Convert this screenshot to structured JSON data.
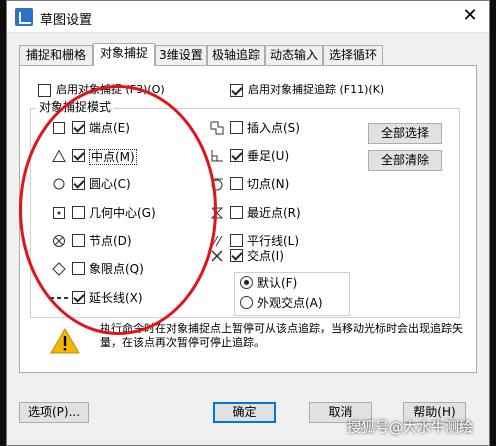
{
  "window": {
    "title": "草图设置",
    "close_symbol": "✕"
  },
  "tabs": [
    {
      "label": "捕捉和栅格"
    },
    {
      "label": "对象捕捉",
      "active": true
    },
    {
      "label": "3维设置"
    },
    {
      "label": "极轴追踪"
    },
    {
      "label": "动态输入"
    },
    {
      "label": "选择循环"
    }
  ],
  "top_checks": {
    "snap_on": {
      "label": "启用对象捕捉 (F3)(O)",
      "checked": false
    },
    "tracking_on": {
      "label": "启用对象捕捉追踪 (F11)(K)",
      "checked": true
    }
  },
  "group_title": "对象捕捉模式",
  "snap_left": [
    {
      "label": "端点(E)",
      "checked": true,
      "icon": "endpoint-square"
    },
    {
      "label": "中点(M)",
      "checked": true,
      "icon": "midpoint-triangle"
    },
    {
      "label": "圆心(C)",
      "checked": true,
      "icon": "center-circle"
    },
    {
      "label": "几何中心(G)",
      "checked": false,
      "icon": "geometric-center"
    },
    {
      "label": "节点(D)",
      "checked": false,
      "icon": "node-x-circle"
    },
    {
      "label": "象限点(Q)",
      "checked": false,
      "icon": "quadrant-diamond"
    },
    {
      "label": "延长线(X)",
      "checked": true,
      "icon": "extension-dashes"
    }
  ],
  "snap_right": [
    {
      "label": "插入点(S)",
      "checked": false,
      "icon": "insertion"
    },
    {
      "label": "垂足(U)",
      "checked": true,
      "icon": "perpendicular"
    },
    {
      "label": "切点(N)",
      "checked": false,
      "icon": "tangent"
    },
    {
      "label": "最近点(R)",
      "checked": false,
      "icon": "nearest-hourglass"
    },
    {
      "label": "平行线(L)",
      "checked": false,
      "icon": "parallel"
    },
    {
      "label": "交点(I)",
      "checked": true,
      "icon": "intersection-x"
    }
  ],
  "buttons": {
    "select_all": "全部选择",
    "clear_all": "全部清除",
    "options": "选项(P)...",
    "ok": "确定",
    "cancel": "取消",
    "help": "帮助(H)"
  },
  "radio": {
    "default": {
      "label": "默认(F)",
      "checked": true
    },
    "apparent": {
      "label": "外观交点(A)",
      "checked": false
    }
  },
  "hint": "执行命令时在对象捕捉点上暂停可从该点追踪，当移动光标时会出现追踪矢量，在该点再次暂停可停止追踪。",
  "watermark": "搜狐号@大水牛测绘",
  "colors": {
    "annotation_circle": "#e1141a",
    "warning": "#f5b800",
    "accent": "#0078d7"
  }
}
